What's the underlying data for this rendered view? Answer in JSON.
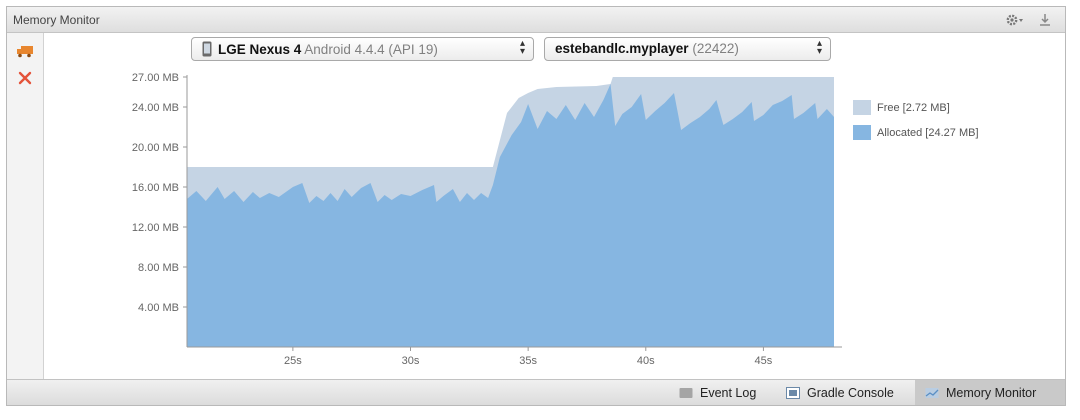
{
  "window": {
    "title": "Memory Monitor"
  },
  "toolbar": {
    "settings_icon": "gear-icon",
    "hide_icon": "hide-panel-icon"
  },
  "sidebar": {
    "gc_icon": "gc-truck-icon",
    "close_icon": "close-icon"
  },
  "device_select": {
    "device": "LGE Nexus 4",
    "os": "Android 4.4.4 (API 19)"
  },
  "process_select": {
    "name": "estebandlc.myplayer",
    "pid": "(22422)"
  },
  "legend": {
    "free": "Free [2.72 MB]",
    "allocated": "Allocated [24.27 MB]"
  },
  "colors": {
    "free": "#c5d4e4",
    "allocated": "#86b6e1",
    "accent_red": "#e4533a",
    "gc_orange": "#e8862e"
  },
  "chart_data": {
    "type": "area",
    "xlabel": "",
    "ylabel": "",
    "y_tick_labels": [
      "4.00 MB",
      "8.00 MB",
      "12.00 MB",
      "16.00 MB",
      "20.00 MB",
      "24.00 MB",
      "27.00 MB"
    ],
    "y_tick_values": [
      4,
      8,
      12,
      16,
      20,
      24,
      27
    ],
    "x_tick_labels": [
      "25s",
      "30s",
      "35s",
      "40s",
      "45s"
    ],
    "x_tick_values": [
      25,
      30,
      35,
      40,
      45
    ],
    "xlim": [
      20.5,
      48
    ],
    "ylim": [
      0,
      27
    ],
    "grid": false,
    "legend_position": "right",
    "series": [
      {
        "name": "Allocated",
        "points": [
          [
            20.5,
            14.8
          ],
          [
            20.9,
            15.6
          ],
          [
            21.3,
            14.6
          ],
          [
            21.8,
            16.0
          ],
          [
            22.1,
            14.8
          ],
          [
            22.5,
            15.6
          ],
          [
            22.9,
            14.5
          ],
          [
            23.3,
            15.5
          ],
          [
            23.6,
            14.9
          ],
          [
            24.0,
            15.4
          ],
          [
            24.4,
            15.0
          ],
          [
            25.0,
            16.0
          ],
          [
            25.4,
            16.4
          ],
          [
            25.7,
            14.4
          ],
          [
            26.0,
            15.1
          ],
          [
            26.3,
            14.6
          ],
          [
            26.6,
            15.4
          ],
          [
            26.9,
            14.6
          ],
          [
            27.2,
            15.8
          ],
          [
            27.5,
            15.0
          ],
          [
            27.9,
            15.9
          ],
          [
            28.3,
            16.4
          ],
          [
            28.6,
            14.5
          ],
          [
            28.9,
            15.2
          ],
          [
            29.2,
            14.7
          ],
          [
            29.6,
            15.3
          ],
          [
            30.0,
            15.1
          ],
          [
            30.5,
            15.7
          ],
          [
            31.0,
            16.2
          ],
          [
            31.1,
            14.5
          ],
          [
            31.4,
            15.1
          ],
          [
            31.8,
            15.8
          ],
          [
            32.1,
            14.5
          ],
          [
            32.4,
            15.4
          ],
          [
            32.7,
            14.7
          ],
          [
            33.0,
            15.4
          ],
          [
            33.3,
            14.9
          ],
          [
            33.5,
            16.2
          ],
          [
            33.8,
            19.0
          ],
          [
            34.3,
            21.2
          ],
          [
            34.7,
            22.5
          ],
          [
            35.0,
            24.3
          ],
          [
            35.4,
            21.8
          ],
          [
            35.8,
            23.6
          ],
          [
            36.2,
            22.8
          ],
          [
            36.6,
            24.2
          ],
          [
            37.0,
            22.7
          ],
          [
            37.4,
            24.4
          ],
          [
            37.8,
            23.0
          ],
          [
            38.2,
            24.7
          ],
          [
            38.5,
            26.3
          ],
          [
            38.7,
            22.1
          ],
          [
            39.0,
            23.3
          ],
          [
            39.4,
            24.0
          ],
          [
            39.8,
            25.3
          ],
          [
            40.0,
            22.7
          ],
          [
            40.4,
            23.6
          ],
          [
            40.8,
            24.4
          ],
          [
            41.2,
            25.4
          ],
          [
            41.5,
            21.7
          ],
          [
            41.9,
            22.4
          ],
          [
            42.3,
            23.0
          ],
          [
            42.7,
            23.8
          ],
          [
            43.0,
            24.7
          ],
          [
            43.3,
            22.2
          ],
          [
            43.7,
            22.8
          ],
          [
            44.1,
            23.5
          ],
          [
            44.5,
            24.5
          ],
          [
            44.6,
            22.6
          ],
          [
            45.0,
            23.2
          ],
          [
            45.4,
            24.2
          ],
          [
            45.8,
            24.6
          ],
          [
            46.2,
            25.2
          ],
          [
            46.3,
            22.8
          ],
          [
            46.7,
            23.4
          ],
          [
            47.2,
            24.4
          ],
          [
            47.3,
            22.8
          ],
          [
            47.7,
            23.8
          ],
          [
            48.0,
            23.0
          ]
        ]
      },
      {
        "name": "Free",
        "points": [
          [
            20.5,
            18.0
          ],
          [
            33.5,
            18.0
          ],
          [
            34.1,
            23.4
          ],
          [
            34.6,
            24.9
          ],
          [
            35.0,
            25.4
          ],
          [
            35.4,
            25.8
          ],
          [
            36.2,
            26.0
          ],
          [
            37.9,
            26.1
          ],
          [
            38.5,
            26.3
          ],
          [
            38.6,
            27.0
          ],
          [
            48.0,
            27.0
          ]
        ]
      }
    ]
  },
  "bottom_tabs": [
    {
      "label": "Event Log",
      "icon": "event-log-icon"
    },
    {
      "label": "Gradle Console",
      "icon": "gradle-console-icon"
    },
    {
      "label": "Memory Monitor",
      "icon": "memory-monitor-icon"
    }
  ]
}
